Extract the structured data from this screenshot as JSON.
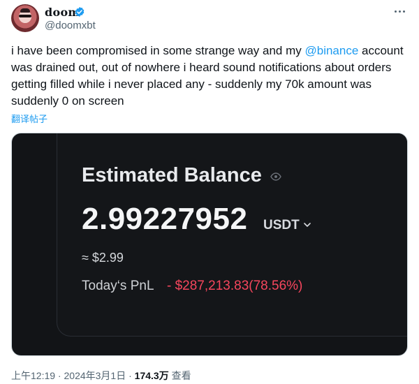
{
  "user": {
    "display_name": "doom",
    "handle": "@doomxbt"
  },
  "tweet": {
    "text_part1": "i have been compromised in some strange way and my ",
    "mention": "@binance",
    "text_part2": " account was drained out, out of nowhere i heard sound notifications about orders getting filled while i never placed any - suddenly my 70k amount was suddenly 0 on screen",
    "translate_label": "翻译帖子"
  },
  "media": {
    "balance_title": "Estimated Balance",
    "balance_value": "2.99227952",
    "balance_unit": "USDT",
    "approx_value": "≈ $2.99",
    "pnl_label": "Today‘s PnL",
    "pnl_value": "- $287,213.83(78.56%)"
  },
  "meta": {
    "time": "上午12:19",
    "separator": " · ",
    "date": "2024年3月1日",
    "views_count": "174.3万",
    "views_label": "查看"
  },
  "colors": {
    "verified_blue": "#1d9bf0",
    "link_blue": "#1d9bf0",
    "loss_red": "#f6465d",
    "card_bg": "#121417"
  },
  "icons": [
    "verified-badge-icon",
    "more-options-icon",
    "eye-icon",
    "chevron-down-icon"
  ]
}
